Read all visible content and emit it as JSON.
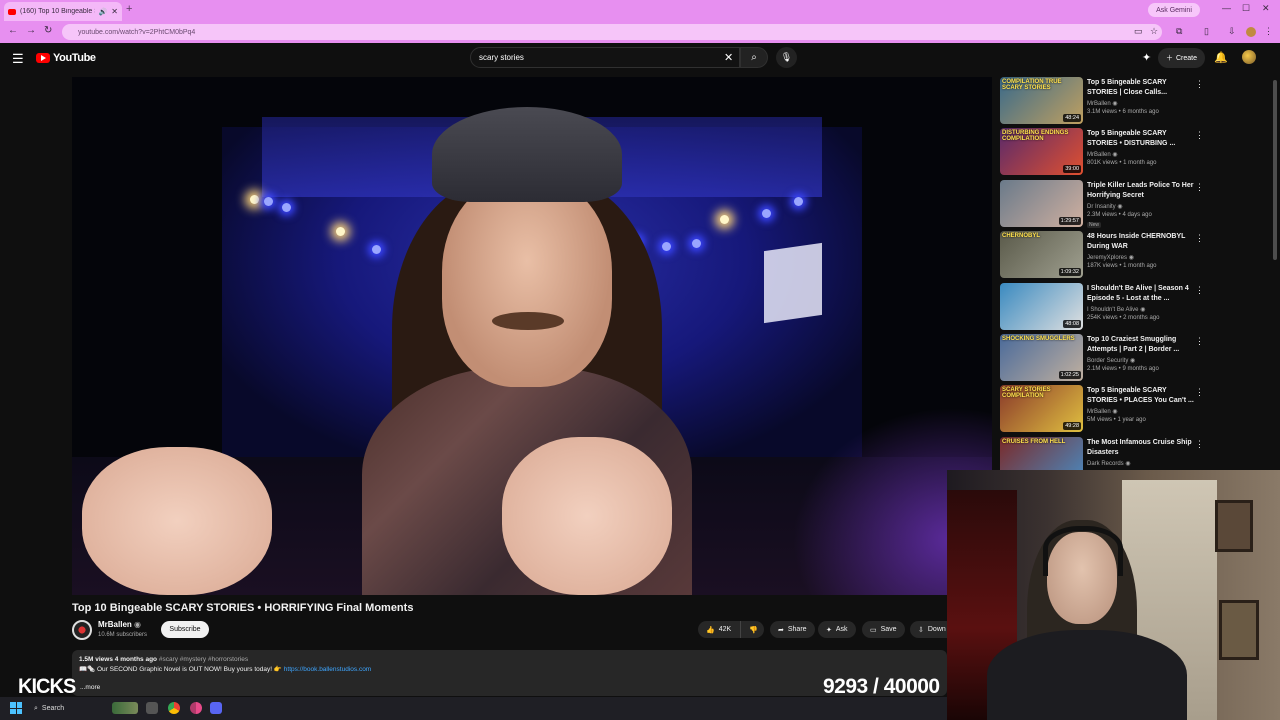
{
  "browser": {
    "tab_title": "(160) Top 10 Bingeable SCARY...",
    "url": "youtube.com/watch?v=2PhtCM0bPq4",
    "ask_gemini": "Ask Gemini"
  },
  "youtube": {
    "logo_text": "YouTube",
    "search_value": "scary stories",
    "create_label": "Create"
  },
  "video": {
    "title": "Top 10 Bingeable SCARY STORIES • HORRIFYING Final Moments",
    "channel": "MrBallen",
    "subscribers": "10.6M subscribers",
    "subscribe_label": "Subscribe",
    "likes": "42K",
    "share_label": "Share",
    "ask_label": "Ask",
    "save_label": "Save",
    "download_label": "Down",
    "desc_stats": "1.5M views  4 months ago",
    "desc_tags": "#scary #mystery #horrorstories",
    "desc_line": "📖🗞️ Our SECOND Graphic Novel is OUT NOW! Buy yours today! 👉",
    "desc_link": "https://book.ballenstudios.com",
    "more": "...more"
  },
  "recommended": [
    {
      "title": "Top 5 Bingeable SCARY STORIES | Close Calls...",
      "channel": "MrBallen",
      "meta": "3.1M views • 6 months ago",
      "duration": "48:24",
      "thumb_text": "COMPILATION  TRUE SCARY STORIES"
    },
    {
      "title": "Top 5 Bingeable SCARY STORIES • DISTURBING ...",
      "channel": "MrBallen",
      "meta": "801K views • 1 month ago",
      "duration": "39:00",
      "thumb_text": "DISTURBING ENDINGS  COMPILATION"
    },
    {
      "title": "Triple Killer Leads Police To Her Horrifying Secret",
      "channel": "Dr Insanity",
      "meta": "2.3M views • 4 days ago",
      "duration": "1:29:57",
      "badge": "New",
      "thumb_text": ""
    },
    {
      "title": "48 Hours Inside CHERNOBYL During WAR",
      "channel": "JeremyXplores",
      "meta": "187K views • 1 month ago",
      "duration": "1:09:32",
      "thumb_text": "CHERNOBYL"
    },
    {
      "title": "I Shouldn't Be Alive | Season 4 Episode 5 - Lost at the ...",
      "channel": "I Shouldn't Be Alive",
      "meta": "254K views • 2 months ago",
      "duration": "48:08",
      "thumb_text": ""
    },
    {
      "title": "Top 10 Craziest Smuggling Attempts | Part 2 | Border ...",
      "channel": "Border Security",
      "meta": "2.1M views • 9 months ago",
      "duration": "1:02:25",
      "thumb_text": "SHOCKING SMUGGLERS"
    },
    {
      "title": "Top 5 Bingeable SCARY STORIES • PLACES You Can't ...",
      "channel": "MrBallen",
      "meta": "5M views • 1 year ago",
      "duration": "49:28",
      "thumb_text": "SCARY STORIES  COMPILATION"
    },
    {
      "title": "The Most Infamous Cruise Ship Disasters",
      "channel": "Dark Records",
      "meta": "",
      "duration": "",
      "thumb_text": "CRUISES FROM HELL"
    }
  ],
  "overlay": {
    "left_text": "KICKS",
    "counter": "9293 / 40000"
  },
  "taskbar": {
    "search_label": "Search"
  }
}
